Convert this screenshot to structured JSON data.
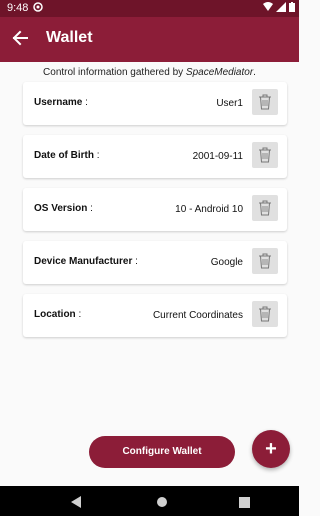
{
  "status_bar": {
    "time": "9:48",
    "notification_icon": "notification-icon",
    "system_icons": [
      "wifi-icon",
      "signal-icon",
      "battery-icon"
    ]
  },
  "app_bar": {
    "title": "Wallet",
    "back_icon": "back-arrow-icon"
  },
  "info": {
    "prefix": "Control information gathered by ",
    "source": "SpaceMediator",
    "suffix": "."
  },
  "items": [
    {
      "label": "Username",
      "separator": " :",
      "value": "User1"
    },
    {
      "label": "Date of Birth",
      "separator": " :",
      "value": "2001-09-11"
    },
    {
      "label": "OS Version",
      "separator": " :",
      "value": "10 - Android 10"
    },
    {
      "label": "Device Manufacturer",
      "separator": " :",
      "value": "Google"
    },
    {
      "label": "Location",
      "separator": " :",
      "value": "Current Coordinates"
    }
  ],
  "configure_button": {
    "label": "Configure Wallet"
  },
  "fab": {
    "label": "+"
  },
  "colors": {
    "primary": "#8c1d38",
    "status_bar": "#6e1429",
    "delete_bg": "#e0e0e0"
  }
}
